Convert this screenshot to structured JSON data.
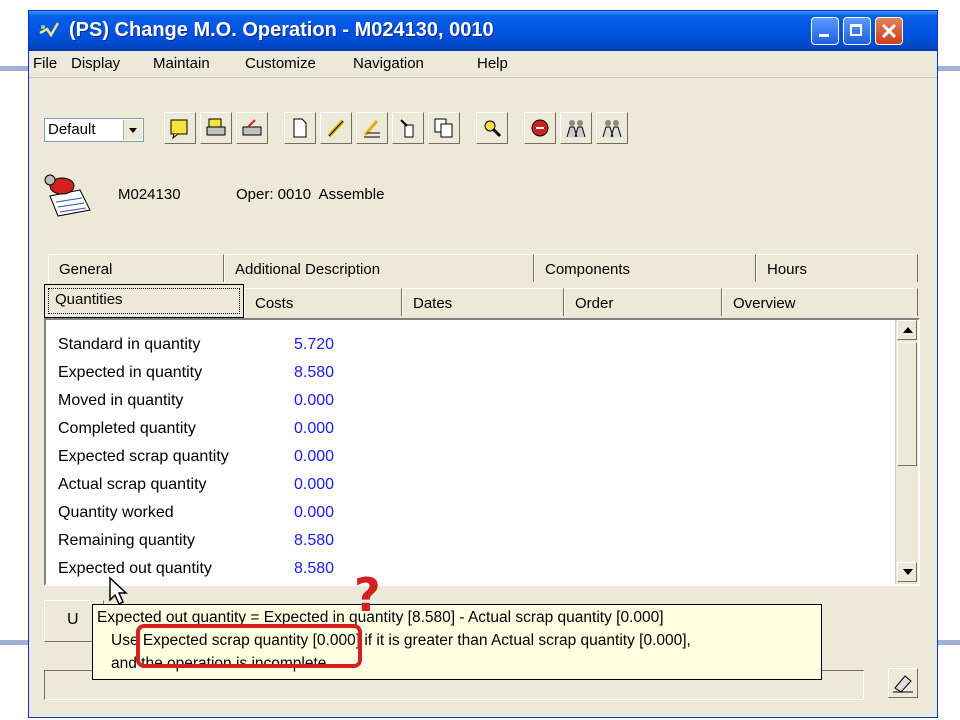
{
  "window": {
    "title": "(PS) Change M.O. Operation - M024130, 0010",
    "title_icon": "ps-app-icon",
    "controls": [
      "minimize-icon",
      "maximize-icon",
      "close-icon"
    ]
  },
  "menu": [
    {
      "label": "File"
    },
    {
      "label": "Display"
    },
    {
      "label": "Maintain"
    },
    {
      "label": "Customize"
    },
    {
      "label": "Navigation"
    },
    {
      "label": "Help"
    }
  ],
  "toolbar": {
    "view_select": "Default",
    "icons": [
      "note-icon",
      "print-icon",
      "printer-icon",
      "new-document-icon",
      "edit-pencil-icon",
      "edit-list-icon",
      "pipette-icon",
      "copy-icon",
      "find-icon",
      "alert-icon",
      "people-icon",
      "people-settings-icon"
    ]
  },
  "header": {
    "mo_number": "M024130",
    "operation": "Oper: 0010  Assemble"
  },
  "tabs_back": [
    {
      "label": "General"
    },
    {
      "label": "Additional Description"
    },
    {
      "label": "Components"
    },
    {
      "label": "Hours"
    }
  ],
  "tabs_front": [
    {
      "label": "Quantities",
      "active": true
    },
    {
      "label": "Costs"
    },
    {
      "label": "Dates"
    },
    {
      "label": "Order"
    },
    {
      "label": "Overview"
    }
  ],
  "quantities": [
    {
      "label": "Standard in quantity",
      "value": "5.720"
    },
    {
      "label": "Expected in quantity",
      "value": "8.580"
    },
    {
      "label": "Moved in quantity",
      "value": "0.000"
    },
    {
      "label": "Completed quantity",
      "value": "0.000"
    },
    {
      "label": "Expected scrap quantity",
      "value": "0.000"
    },
    {
      "label": "Actual scrap quantity",
      "value": "0.000"
    },
    {
      "label": "Quantity worked",
      "value": "0.000"
    },
    {
      "label": "Remaining quantity",
      "value": "8.580"
    },
    {
      "label": "Expected out quantity",
      "value": "8.580"
    }
  ],
  "lower_button_label": "U",
  "tooltip": {
    "line1": "Expected out quantity = Expected in quantity [8.580] - Actual scrap quantity [0.000]",
    "line2": "Use Expected scrap quantity [0.000] if it is greater than Actual scrap quantity [0.000],",
    "line3": "and the operation is incomplete."
  },
  "annotation": {
    "question_mark": "?",
    "color": "#d42020"
  }
}
